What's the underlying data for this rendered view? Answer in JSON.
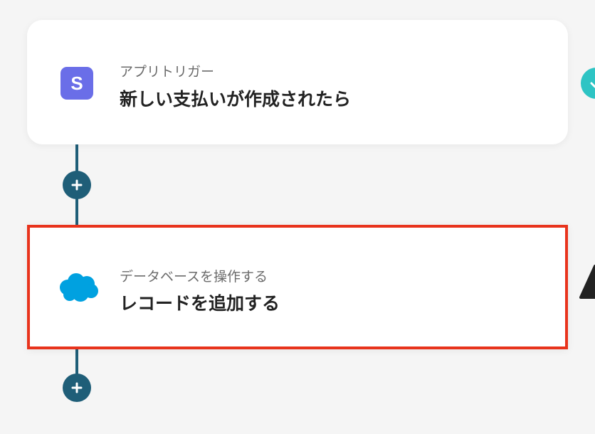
{
  "flow": {
    "steps": [
      {
        "sublabel": "アプリトリガー",
        "title": "新しい支払いが作成されたら",
        "icon": "stripe-icon",
        "status": "complete-check-icon"
      },
      {
        "sublabel": "データベースを操作する",
        "title": "レコードを追加する",
        "icon": "salesforce-icon",
        "status": "warning-icon"
      }
    ],
    "add_step_icon": "plus-icon"
  },
  "colors": {
    "connector": "#1f5e78",
    "highlight_border": "#e8331c",
    "check": "#2ec4c4",
    "stripe": "#6a6ee8",
    "salesforce": "#00a1e0"
  }
}
